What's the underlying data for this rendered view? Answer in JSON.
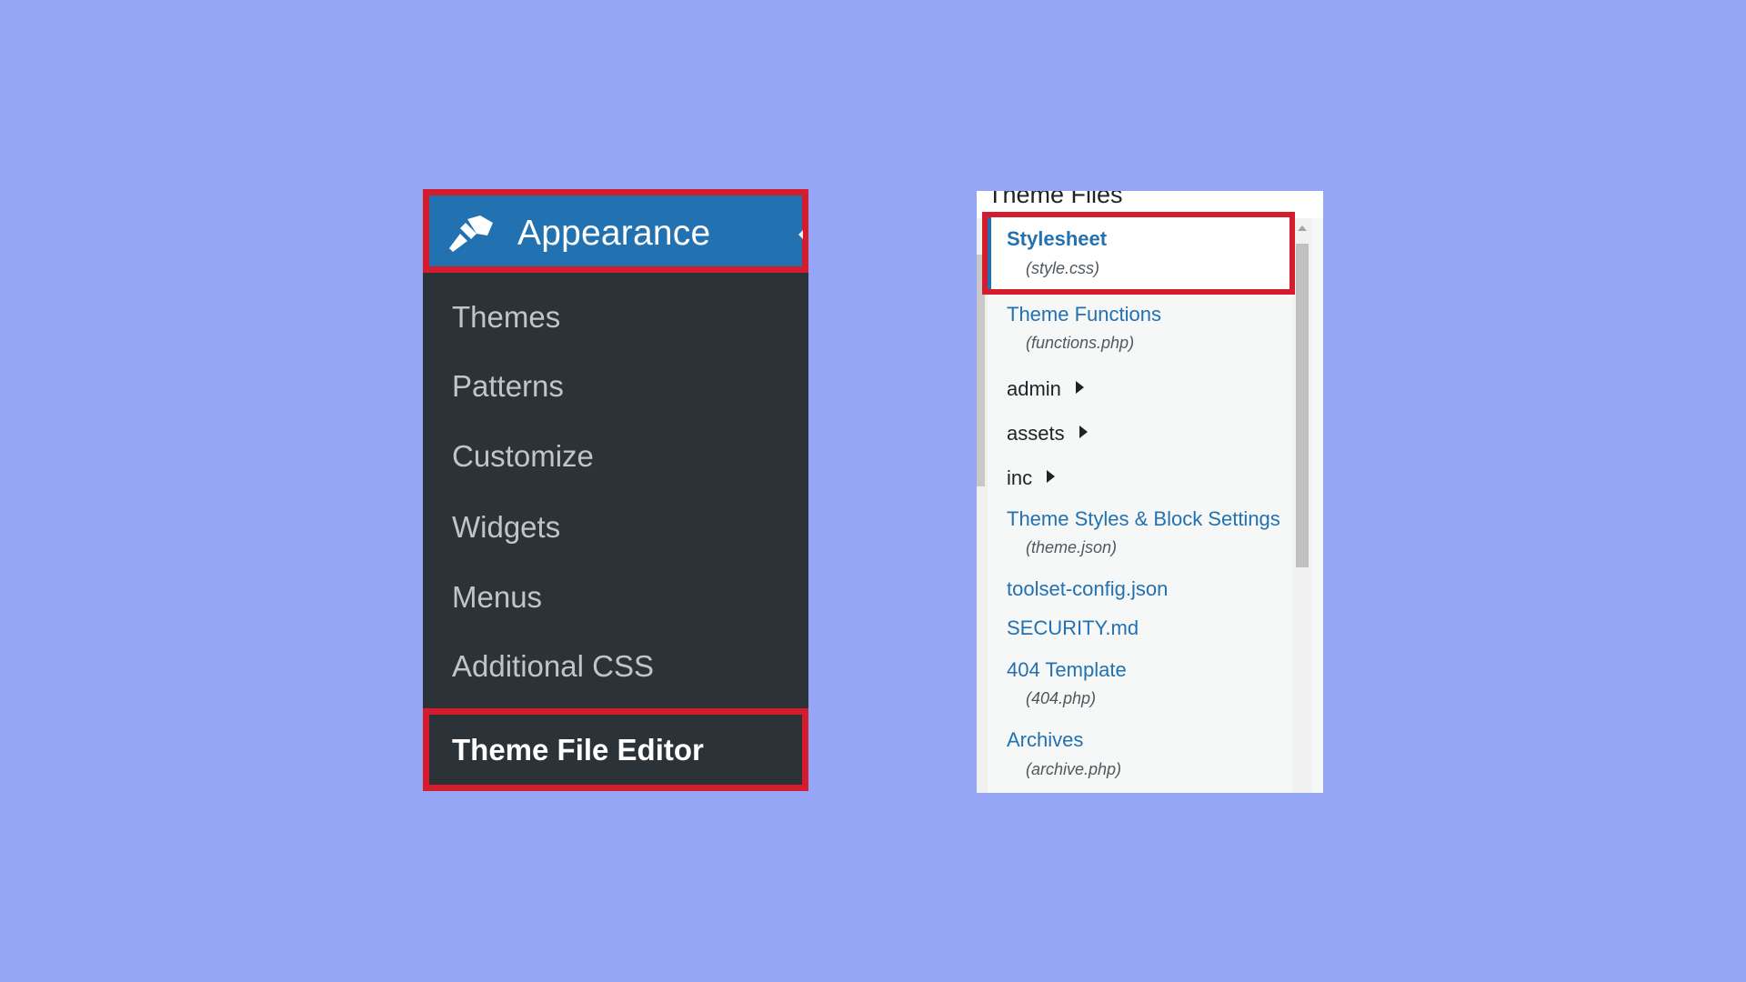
{
  "menu": {
    "title": "Appearance",
    "icon": "paintbrush-icon",
    "items": [
      {
        "label": "Themes"
      },
      {
        "label": "Patterns"
      },
      {
        "label": "Customize"
      },
      {
        "label": "Widgets"
      },
      {
        "label": "Menus"
      },
      {
        "label": "Additional CSS"
      }
    ],
    "current": {
      "label": "Theme File Editor"
    }
  },
  "files": {
    "title": "Theme Files",
    "selected": {
      "name": "Stylesheet",
      "file": "(style.css)"
    },
    "entries": [
      {
        "name": "Theme Functions",
        "file": "(functions.php)"
      },
      {
        "folder": "admin"
      },
      {
        "folder": "assets"
      },
      {
        "folder": "inc"
      },
      {
        "name": "Theme Styles & Block Settings",
        "file": "(theme.json)"
      },
      {
        "name": "toolset-config.json"
      },
      {
        "name": "SECURITY.md"
      },
      {
        "name": "404 Template",
        "file": "(404.php)"
      },
      {
        "name": "Archives",
        "file": "(archive.php)"
      }
    ]
  },
  "colors": {
    "background": "#96a6f7",
    "menu_bg": "#2c3338",
    "menu_header": "#2271b1",
    "highlight_border": "#d41c2c",
    "link": "#2271b1"
  }
}
